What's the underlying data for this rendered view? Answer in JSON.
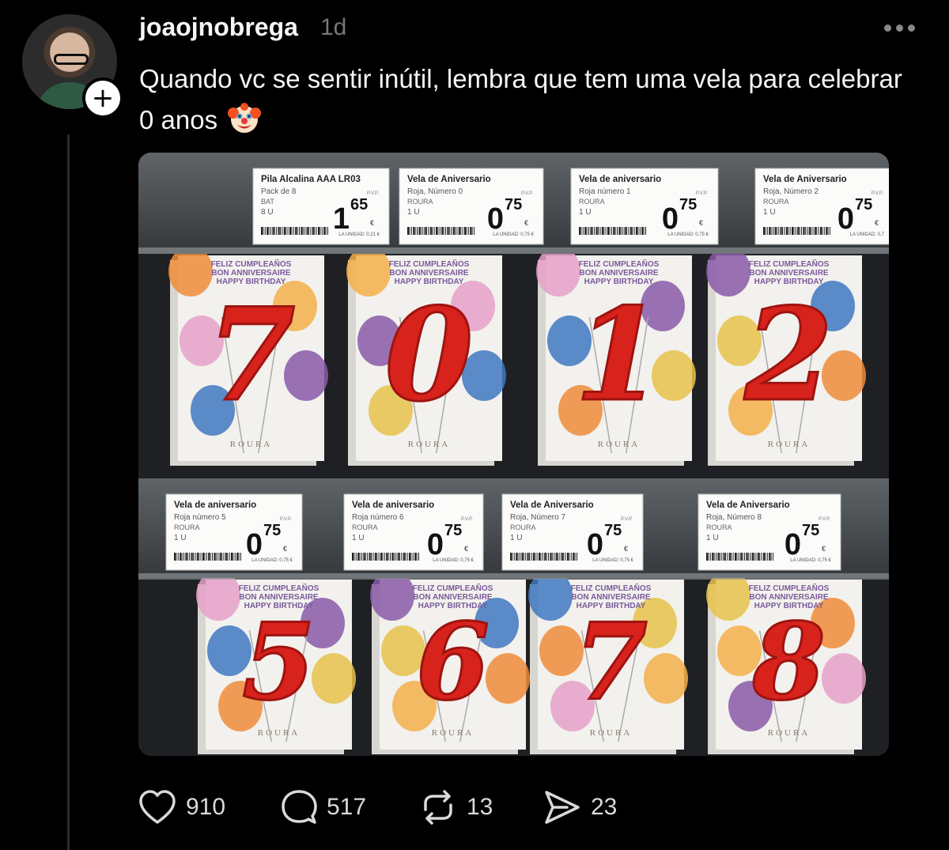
{
  "post": {
    "author": "joaojnobrega",
    "time": "1d",
    "text": "Quando vc se sentir inútil, lembra que tem uma vela para celebrar 0 anos",
    "emoji": "clown-face"
  },
  "photo": {
    "top_shelf": {
      "labels": [
        {
          "title": "Pila Alcalina AAA LR03",
          "line1": "Pack de 8",
          "line2": "BAT",
          "line3": "8 U",
          "price_int": "1",
          "price_dec": "65",
          "unit": "LA UNIDAD: 0,21 €"
        },
        {
          "title": "Vela de Aniversario",
          "line1": "Roja, Número 0",
          "line2": "ROURA",
          "line3": "1 U",
          "price_int": "0",
          "price_dec": "75",
          "unit": "LA UNIDAD: 0,75 €"
        },
        {
          "title": "Vela de aniversario",
          "line1": "Roja número 1",
          "line2": "ROURA",
          "line3": "1 U",
          "price_int": "0",
          "price_dec": "75",
          "unit": "LA UNIDAD: 0,75 €"
        },
        {
          "title": "Vela de Aniversario",
          "line1": "Roja, Número 2",
          "line2": "ROURA",
          "line3": "1 U",
          "price_int": "0",
          "price_dec": "75",
          "unit": "LA UNIDAD: 0,7"
        }
      ],
      "candles": [
        "7",
        "0",
        "1",
        "2"
      ]
    },
    "bottom_shelf": {
      "labels": [
        {
          "title": "Vela de aniversario",
          "line1": "Roja número 5",
          "line2": "ROURA",
          "line3": "1 U",
          "price_int": "0",
          "price_dec": "75",
          "unit": "LA UNIDAD: 0,75 €"
        },
        {
          "title": "Vela de aniversario",
          "line1": "Roja número 6",
          "line2": "ROURA",
          "line3": "1 U",
          "price_int": "0",
          "price_dec": "75",
          "unit": "LA UNIDAD: 0,75 €"
        },
        {
          "title": "Vela de Aniversario",
          "line1": "Roja, Número 7",
          "line2": "ROURA",
          "line3": "1 U",
          "price_int": "0",
          "price_dec": "75",
          "unit": "LA UNIDAD: 0,75 €"
        },
        {
          "title": "Vela de Aniversario",
          "line1": "Roja, Número 8",
          "line2": "ROURA",
          "line3": "1 U",
          "price_int": "0",
          "price_dec": "75",
          "unit": "LA UNIDAD: 0,75 €"
        }
      ],
      "candles": [
        "5",
        "6",
        "7",
        "8"
      ]
    },
    "package_text": [
      "FELIZ CUMPLEAÑOS",
      "BON ANNIVERSAIRE",
      "HAPPY BIRTHDAY"
    ],
    "brand": "ROURA",
    "pvp": "P.V.P.",
    "currency": "€"
  },
  "actions": {
    "likes": "910",
    "replies": "517",
    "reposts": "13",
    "shares": "23"
  },
  "colors": {
    "background": "#000000",
    "text": "#f3f5f7",
    "muted": "#777777",
    "candle_red": "#d8221c"
  }
}
